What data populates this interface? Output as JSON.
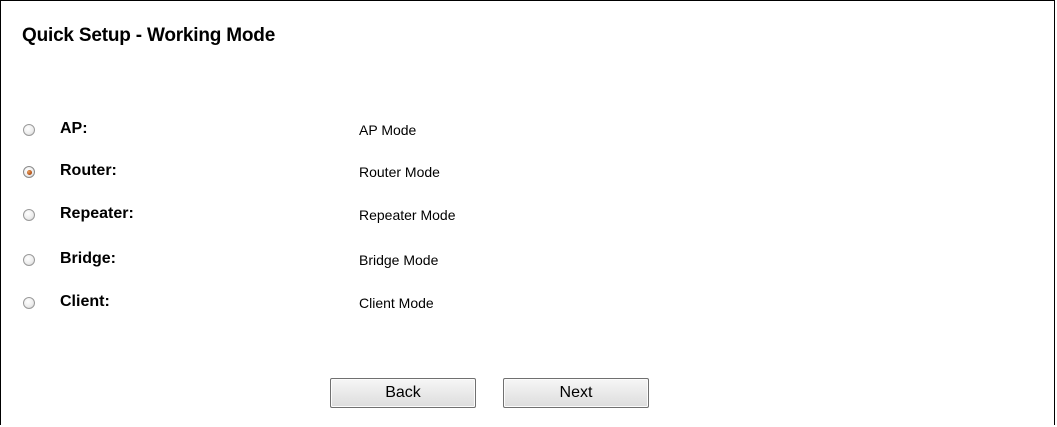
{
  "page": {
    "title": "Quick Setup - Working Mode"
  },
  "modes": [
    {
      "label": "AP:",
      "description": "AP Mode",
      "selected": false
    },
    {
      "label": "Router:",
      "description": "Router Mode",
      "selected": true
    },
    {
      "label": "Repeater:",
      "description": "Repeater Mode",
      "selected": false
    },
    {
      "label": "Bridge:",
      "description": "Bridge Mode",
      "selected": false
    },
    {
      "label": "Client:",
      "description": "Client Mode",
      "selected": false
    }
  ],
  "buttons": {
    "back_label": "Back",
    "next_label": "Next"
  },
  "colors": {
    "selected_radio": "#b8561a",
    "border": "#000000"
  }
}
